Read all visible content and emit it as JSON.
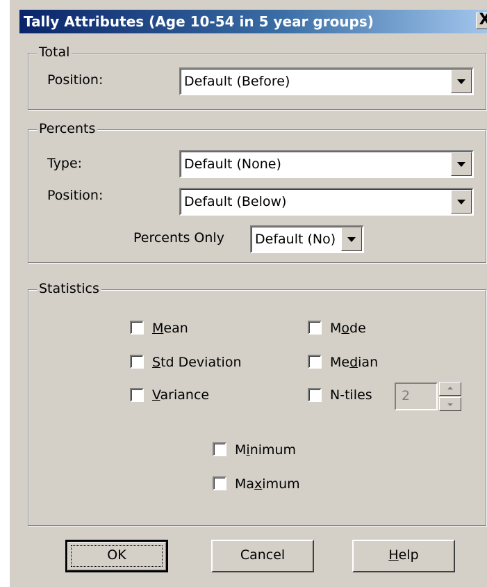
{
  "window": {
    "title": "Tally Attributes (Age 10-54 in 5 year groups)",
    "close_label": "X"
  },
  "total": {
    "group_label": "Total",
    "position_label": "Position:",
    "position_value": "Default (Before)"
  },
  "percents": {
    "group_label": "Percents",
    "type_label": "Type:",
    "type_value": "Default (None)",
    "position_label": "Position:",
    "position_value": "Default (Below)",
    "only_label": "Percents Only",
    "only_value": "Default (No)"
  },
  "statistics": {
    "group_label": "Statistics",
    "mean": {
      "pre": "",
      "key": "M",
      "post": "ean",
      "checked": false
    },
    "std_dev": {
      "pre": "",
      "key": "S",
      "post": "td Deviation",
      "checked": false
    },
    "variance": {
      "pre": "",
      "key": "V",
      "post": "ariance",
      "checked": false
    },
    "mode": {
      "pre": "M",
      "key": "o",
      "post": "de",
      "checked": false
    },
    "median": {
      "pre": "Me",
      "key": "d",
      "post": "ian",
      "checked": false
    },
    "ntiles": {
      "label": "N-tiles",
      "checked": false,
      "value": "2"
    },
    "minimum": {
      "pre": "M",
      "key": "i",
      "post": "nimum",
      "checked": false
    },
    "maximum": {
      "pre": "Ma",
      "key": "x",
      "post": "imum",
      "checked": false
    }
  },
  "buttons": {
    "ok": "OK",
    "cancel": "Cancel",
    "help": {
      "key": "H",
      "post": "elp"
    }
  }
}
